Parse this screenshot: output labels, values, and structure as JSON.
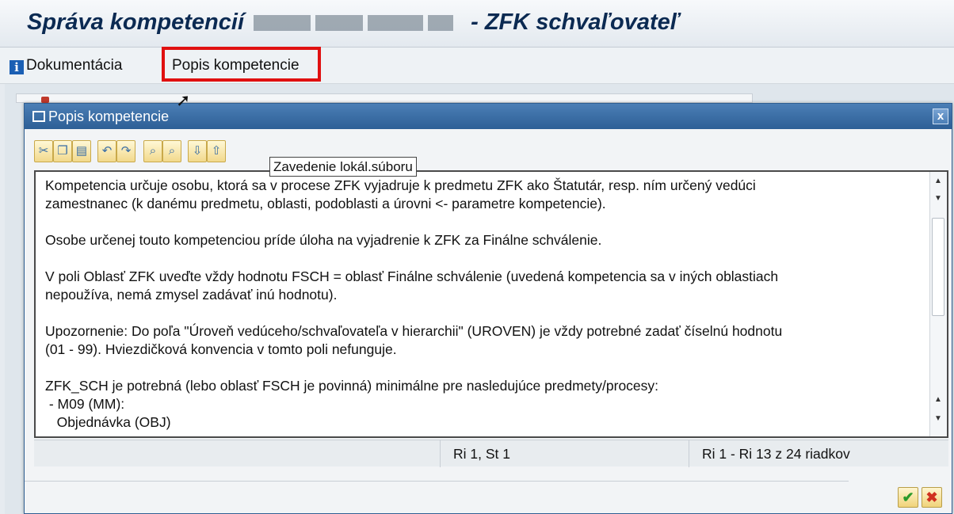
{
  "window": {
    "title_prefix": "Správa kompetencií",
    "title_suffix": "- ZFK schvaľovateľ"
  },
  "menu": {
    "documentation": "Dokumentácia",
    "competence_description": "Popis kompetencie"
  },
  "dialog": {
    "title": "Popis kompetencie",
    "close": "x",
    "tooltip": "Zavedenie lokál.súboru",
    "editor_text": "Kompetencia určuje osobu, ktorá sa v procese ZFK vyjadruje k predmetu ZFK ako Štatutár, resp. ním určený vedúci\nzamestnanec (k danému predmetu, oblasti, podoblasti a úrovni <- parametre kompetencie).\n\nOsobe určenej touto kompetenciou príde úloha na vyjadrenie k ZFK za Finálne schválenie.\n\nV poli Oblasť ZFK uveďte vždy hodnotu FSCH = oblasť Finálne schválenie (uvedená kompetencia sa v iných oblastiach\nnepoužíva, nemá zmysel zadávať inú hodnotu).\n\nUpozornenie: Do poľa \"Úroveň vedúceho/schvaľovateľa v hierarchii\" (UROVEN) je vždy potrebné zadať číselnú hodnotu\n(01 - 99). Hviezdičková konvencia v tomto poli nefunguje.\n\nZFK_SCH je potrebná (lebo oblasť FSCH je povinná) minimálne pre nasledujúce predmety/procesy:\n - M09 (MM):\n   Objednávka (OBJ)",
    "status_position": "Ri 1, St 1",
    "status_lines": "Ri 1 - Ri 13 z 24 riadkov"
  },
  "colors": {
    "title_text": "#0b2a52",
    "dialog_header": "#2d5f96",
    "highlight": "#e01010"
  }
}
